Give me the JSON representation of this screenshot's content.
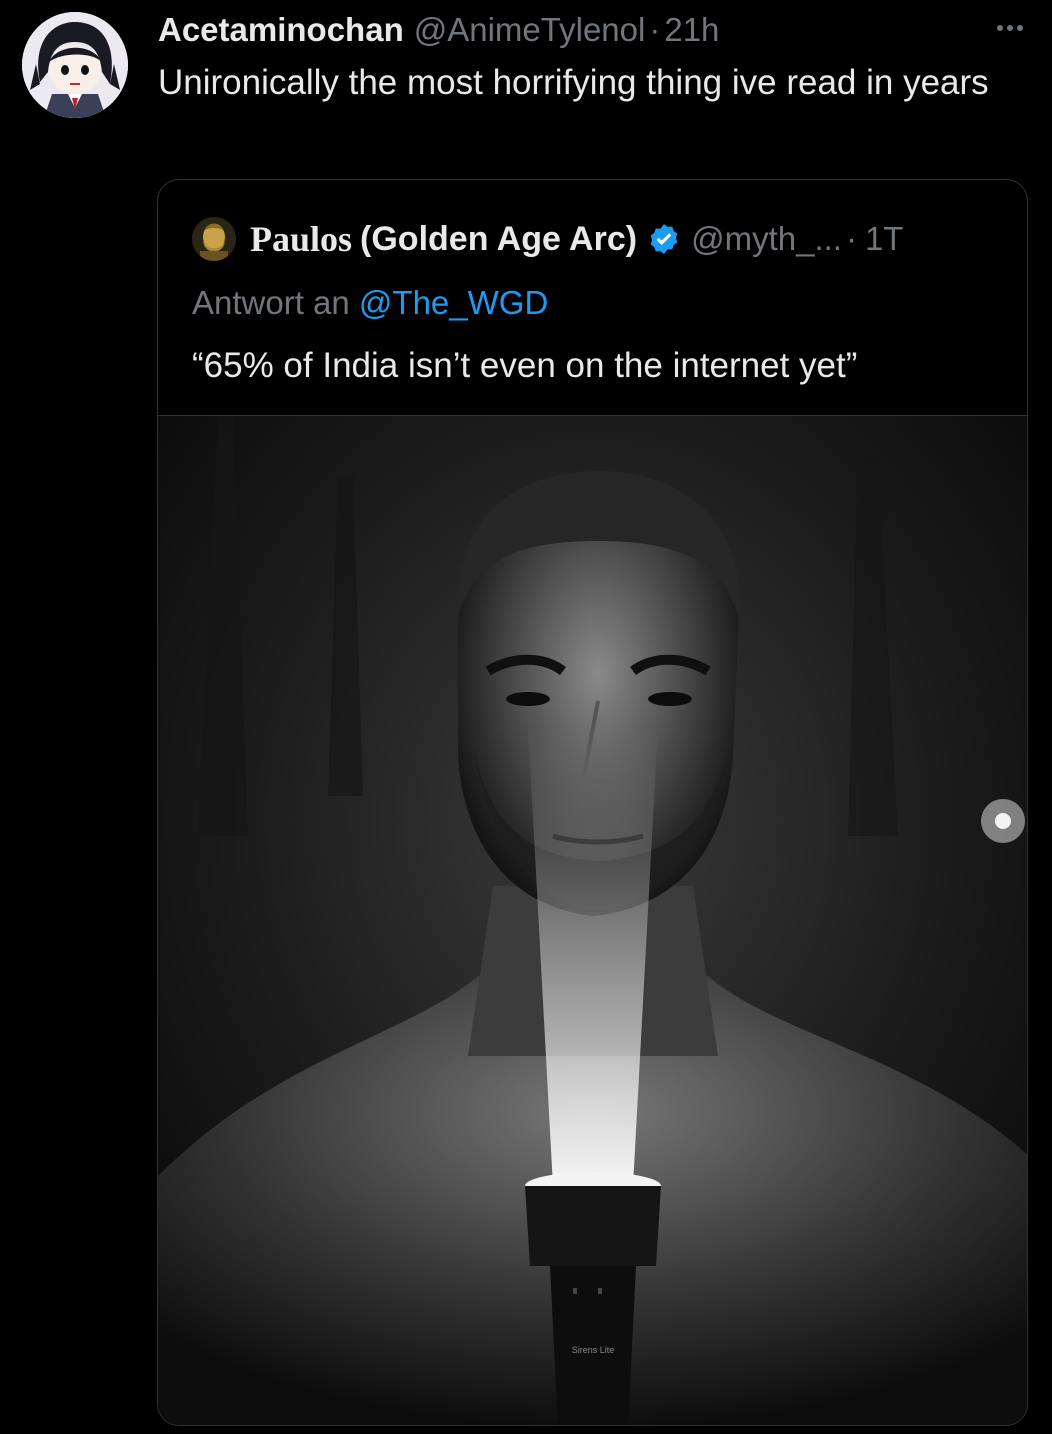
{
  "tweet": {
    "display_name": "Acetaminochan",
    "handle": "@AnimeTylenol",
    "separator": "·",
    "time": "21h",
    "more_icon": "more-icon",
    "text": "Unironically the most horrifying thing ive read in years"
  },
  "quote": {
    "name_prefix": "Paulos",
    "name_rest": "(Golden Age Arc)",
    "verified_icon": "verified-badge-icon",
    "handle": "@myth_...",
    "separator": "·",
    "time": "1T",
    "reply_prefix": "Antwort an",
    "reply_mention": "@The_WGD",
    "text": "“65% of India isn’t even on the internet yet”",
    "media_label": "Sirens Lite"
  },
  "colors": {
    "background": "#000000",
    "text_primary": "#e7e9ea",
    "text_secondary": "#71767b",
    "link": "#1d9bf0",
    "border": "#2f3336"
  }
}
